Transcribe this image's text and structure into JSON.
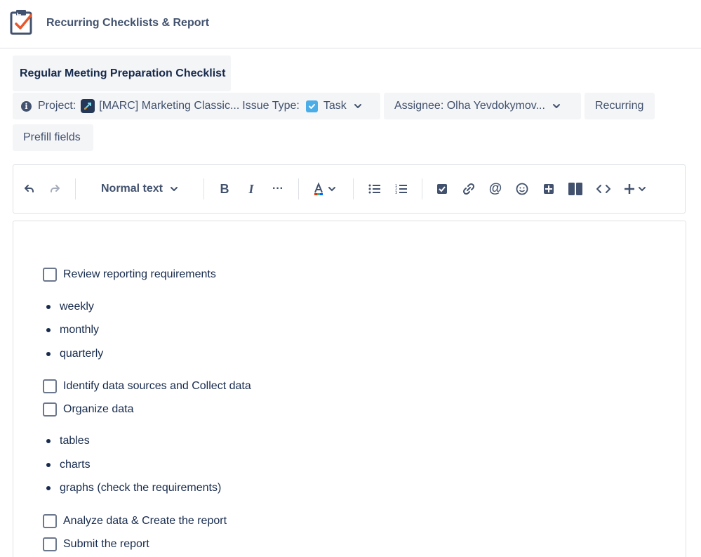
{
  "app": {
    "title": "Recurring Checklists & Report"
  },
  "template": {
    "title": "Regular Meeting Preparation Checklist",
    "project_label": "Project:",
    "project_value": "[MARC] Marketing Classic...",
    "issue_type_label": "Issue Type:",
    "issue_type_value": "Task",
    "assignee": "Assignee: Olha Yevdokymov...",
    "recurring": "Recurring",
    "prefill": "Prefill fields"
  },
  "toolbar": {
    "text_style": "Normal text",
    "icons": [
      "undo-icon",
      "redo-icon",
      "bold-icon",
      "italic-icon",
      "more-formatting-icon",
      "text-color-icon",
      "bullet-list-icon",
      "numbered-list-icon",
      "action-item-icon",
      "link-icon",
      "mention-icon",
      "emoji-icon",
      "table-icon",
      "layouts-icon",
      "code-icon",
      "insert-icon"
    ]
  },
  "editor": {
    "items": [
      {
        "type": "checkbox",
        "text": "Review reporting requirements"
      },
      {
        "type": "bullet",
        "text": "weekly"
      },
      {
        "type": "bullet",
        "text": "monthly"
      },
      {
        "type": "bullet",
        "text": "quarterly"
      },
      {
        "type": "checkbox",
        "text": "Identify data sources and Collect data"
      },
      {
        "type": "checkbox",
        "text": "Organize data"
      },
      {
        "type": "bullet",
        "text": "tables"
      },
      {
        "type": "bullet",
        "text": "charts"
      },
      {
        "type": "bullet",
        "text": "graphs (check the requirements)"
      },
      {
        "type": "checkbox",
        "text": "Analyze data & Create the report"
      },
      {
        "type": "checkbox",
        "text": "Submit the report"
      }
    ]
  },
  "colors": {
    "brand_check": "#e8562a",
    "task_icon": "#4bade8",
    "chip_bg": "#f4f5f7"
  }
}
